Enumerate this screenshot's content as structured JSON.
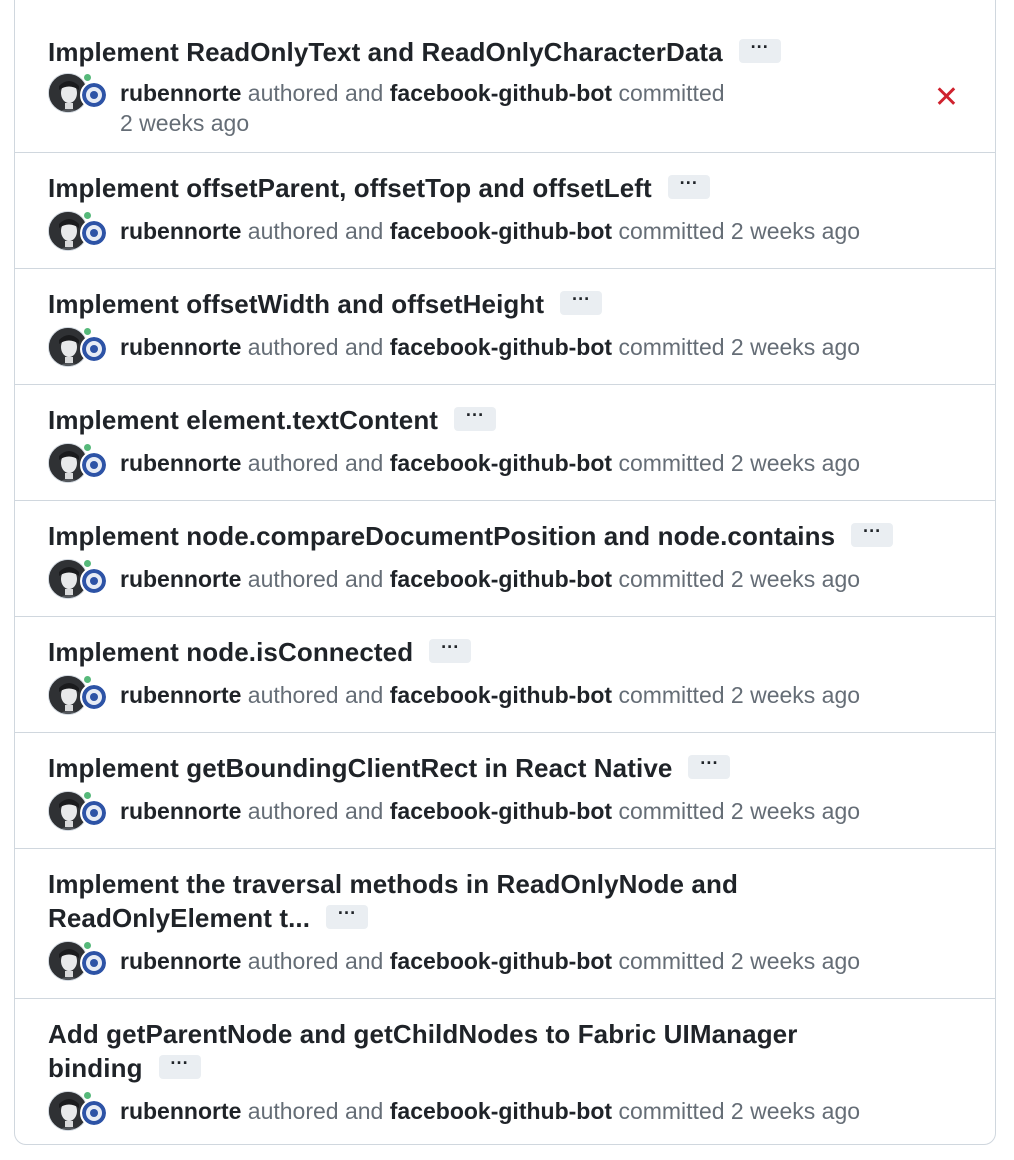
{
  "commits": [
    {
      "title": "Implement ReadOnlyText and ReadOnlyCharacterData",
      "title_line2": "",
      "author": "rubennorte",
      "authored_text": "authored and",
      "committer": "facebook-github-bot",
      "committed_text": "committed",
      "time": "2 weeks ago",
      "status": "failure",
      "status_icon": "x-icon"
    },
    {
      "title": "Implement offsetParent, offsetTop and offsetLeft",
      "author": "rubennorte",
      "authored_text": "authored and",
      "committer": "facebook-github-bot",
      "committed_text": "committed",
      "time": "2 weeks ago"
    },
    {
      "title": "Implement offsetWidth and offsetHeight",
      "author": "rubennorte",
      "authored_text": "authored and",
      "committer": "facebook-github-bot",
      "committed_text": "committed",
      "time": "2 weeks ago"
    },
    {
      "title": "Implement element.textContent",
      "author": "rubennorte",
      "authored_text": "authored and",
      "committer": "facebook-github-bot",
      "committed_text": "committed",
      "time": "2 weeks ago"
    },
    {
      "title": "Implement node.compareDocumentPosition and node.contains",
      "author": "rubennorte",
      "authored_text": "authored and",
      "committer": "facebook-github-bot",
      "committed_text": "committed",
      "time": "2 weeks ago"
    },
    {
      "title": "Implement node.isConnected",
      "author": "rubennorte",
      "authored_text": "authored and",
      "committer": "facebook-github-bot",
      "committed_text": "committed",
      "time": "2 weeks ago"
    },
    {
      "title": "Implement getBoundingClientRect in React Native",
      "author": "rubennorte",
      "authored_text": "authored and",
      "committer": "facebook-github-bot",
      "committed_text": "committed",
      "time": "2 weeks ago"
    },
    {
      "title": "Implement the traversal methods in ReadOnlyNode and",
      "title_line2": "ReadOnlyElement t...",
      "author": "rubennorte",
      "authored_text": "authored and",
      "committer": "facebook-github-bot",
      "committed_text": "committed",
      "time": "2 weeks ago"
    },
    {
      "title": "Add getParentNode and getChildNodes to Fabric UIManager",
      "title_line2": "binding",
      "author": "rubennorte",
      "authored_text": "authored and",
      "committer": "facebook-github-bot",
      "committed_text": "committed",
      "time": "2 weeks ago"
    }
  ],
  "ellipsis_label": "···",
  "status_x_glyph": "✕",
  "colors": {
    "failure": "#cf222e",
    "link": "#1f2328",
    "muted": "#656d76",
    "border": "#d0d7de"
  }
}
